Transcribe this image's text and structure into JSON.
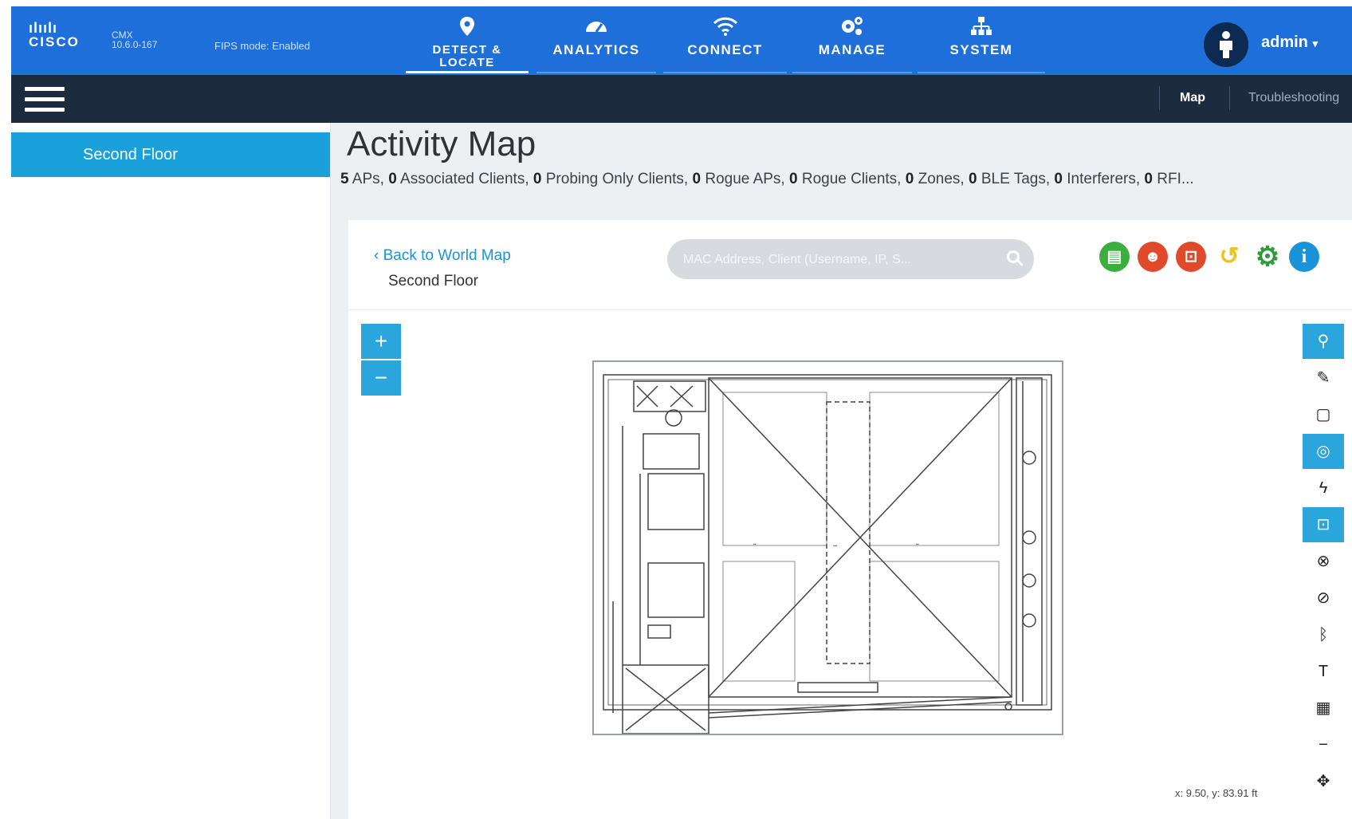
{
  "header": {
    "brand": "CISCO",
    "product": "CMX",
    "version": "10.6.0-167",
    "fips": "FIPS mode: Enabled",
    "nav": [
      {
        "label": "DETECT & LOCATE",
        "icon": "location-pin-icon",
        "active": true
      },
      {
        "label": "ANALYTICS",
        "icon": "dashboard-gauge-icon",
        "active": false
      },
      {
        "label": "CONNECT",
        "icon": "wifi-icon",
        "active": false
      },
      {
        "label": "MANAGE",
        "icon": "gears-icon",
        "active": false
      },
      {
        "label": "SYSTEM",
        "icon": "hierarchy-icon",
        "active": false
      }
    ],
    "user": "admin"
  },
  "subheader": {
    "tabs": [
      {
        "label": "Map",
        "active": true
      },
      {
        "label": "Troubleshooting",
        "active": false
      }
    ]
  },
  "sidebar": {
    "items": [
      {
        "label": "Second Floor",
        "selected": true
      }
    ]
  },
  "main": {
    "title": "Activity Map",
    "summary": [
      {
        "count": "5",
        "label": "APs,"
      },
      {
        "count": "0",
        "label": "Associated Clients,"
      },
      {
        "count": "0",
        "label": "Probing Only Clients,"
      },
      {
        "count": "0",
        "label": "Rogue APs,"
      },
      {
        "count": "0",
        "label": "Rogue Clients,"
      },
      {
        "count": "0",
        "label": "Zones,"
      },
      {
        "count": "0",
        "label": "BLE Tags,"
      },
      {
        "count": "0",
        "label": "Interferers,"
      },
      {
        "count": "0",
        "label": "RFI..."
      }
    ],
    "back_link": "Back to World Map",
    "floor": "Second Floor",
    "search_placeholder": "MAC Address, Client (Username, IP, S...",
    "tool_buttons": [
      {
        "icon": "report-icon",
        "color": "#3cae3f"
      },
      {
        "icon": "client-icon",
        "color": "#e04a2a"
      },
      {
        "icon": "lock-icon",
        "color": "#e04a2a"
      },
      {
        "icon": "history-icon",
        "color": "#f2c21c"
      },
      {
        "icon": "settings-gear-icon",
        "color": "#2e9c3a"
      },
      {
        "icon": "info-icon",
        "color": "#1a93d8"
      }
    ],
    "zoom": {
      "in": "+",
      "out": "−"
    },
    "right_tools": [
      {
        "icon": "pin-icon",
        "glyph": "⚲",
        "on": true
      },
      {
        "icon": "pencil-icon",
        "glyph": "✎",
        "on": false
      },
      {
        "icon": "square-icon",
        "glyph": "▢",
        "on": false
      },
      {
        "icon": "target-icon",
        "glyph": "◎",
        "on": true
      },
      {
        "icon": "lightning-icon",
        "glyph": "ϟ",
        "on": false
      },
      {
        "icon": "tag-lock-icon",
        "glyph": "⊡",
        "on": true
      },
      {
        "icon": "clients-off-icon",
        "glyph": "⊗",
        "on": false
      },
      {
        "icon": "slash-icon",
        "glyph": "⊘",
        "on": false
      },
      {
        "icon": "bluetooth-icon",
        "glyph": "ᛒ",
        "on": false
      },
      {
        "icon": "filter-icon",
        "glyph": "T",
        "on": false
      },
      {
        "icon": "grid-icon",
        "glyph": "▦",
        "on": false
      },
      {
        "icon": "minus-icon",
        "glyph": "−",
        "on": false
      },
      {
        "icon": "crosshair-icon",
        "glyph": "✥",
        "on": false
      }
    ],
    "coords": "x: 9.50, y: 83.91 ft"
  }
}
